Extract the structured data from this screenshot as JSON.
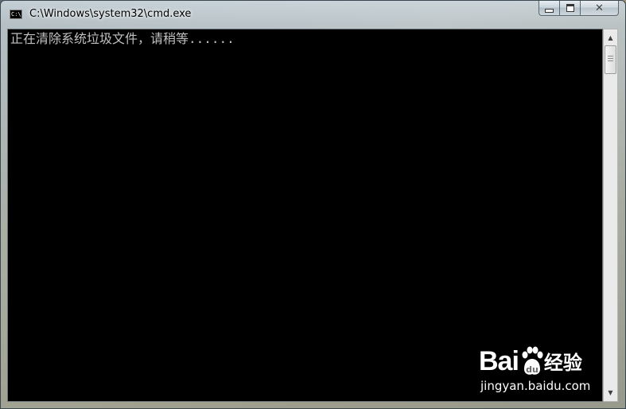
{
  "window": {
    "title": "C:\\Windows\\system32\\cmd.exe",
    "icon_label": "C:\\",
    "buttons": {
      "minimize_icon": "minimize-icon",
      "maximize_icon": "maximize-icon",
      "close_icon": "close-icon",
      "close_glyph": "✕"
    }
  },
  "console": {
    "background": "#000000",
    "text_color": "#c0c0c0",
    "lines": [
      "正在清除系统垃圾文件，请稍等......"
    ]
  },
  "scrollbar": {
    "up_arrow": "▲",
    "down_arrow": "▼"
  },
  "watermark": {
    "logo_prefix": "Bai",
    "logo_suffix": "经验",
    "url": "jingyan.baidu.com"
  }
}
